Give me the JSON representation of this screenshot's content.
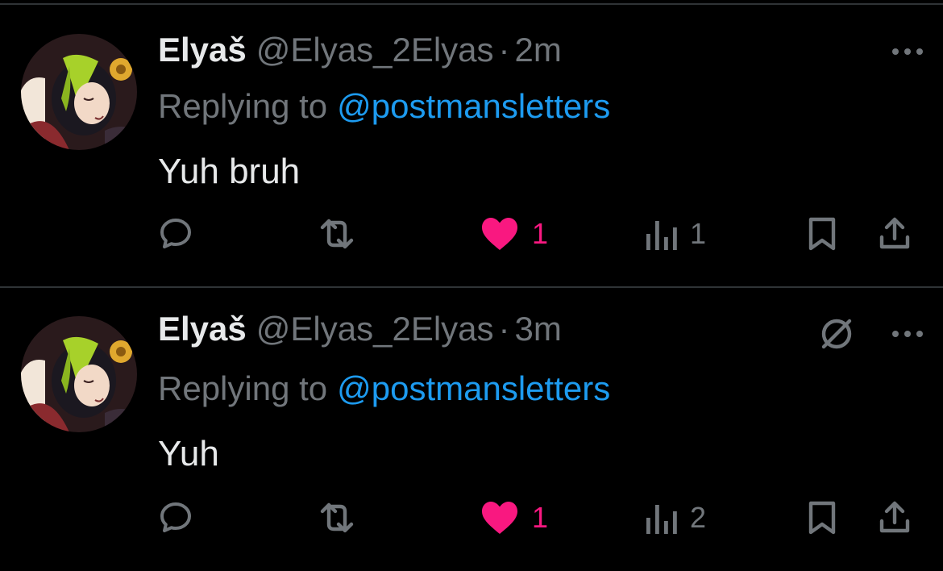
{
  "colors": {
    "background": "#000000",
    "primary_text": "#e7e9ea",
    "secondary_text": "#71767b",
    "link": "#1d9bf0",
    "like": "#f91880",
    "divider": "#2f3336"
  },
  "tweets": [
    {
      "display_name": "Elyaš",
      "handle": "@Elyas_2Elyas",
      "separator": "·",
      "time": "2m",
      "replying_prefix": "Replying to",
      "replying_to": "@postmansletters",
      "text": "Yuh bruh",
      "liked": true,
      "like_count": "1",
      "view_count": "1",
      "icons": [
        "reply-icon",
        "retweet-icon",
        "heart-icon",
        "views-icon",
        "bookmark-icon",
        "share-icon",
        "more-icon"
      ]
    },
    {
      "display_name": "Elyaš",
      "handle": "@Elyas_2Elyas",
      "separator": "·",
      "time": "3m",
      "replying_prefix": "Replying to",
      "replying_to": "@postmansletters",
      "text": "Yuh",
      "liked": true,
      "like_count": "1",
      "view_count": "2",
      "icons": [
        "hidden-reply-icon",
        "reply-icon",
        "retweet-icon",
        "heart-icon",
        "views-icon",
        "bookmark-icon",
        "share-icon",
        "more-icon"
      ]
    }
  ]
}
